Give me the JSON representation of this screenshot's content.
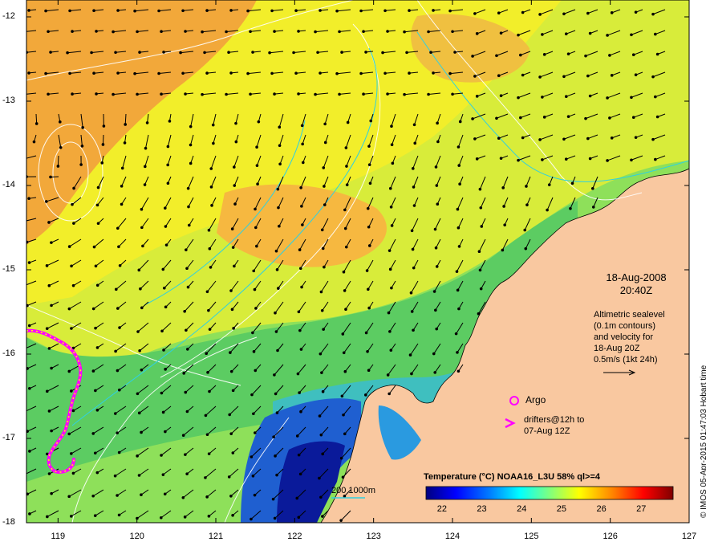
{
  "map": {
    "lon_range": [
      118.6,
      127
    ],
    "lat_range": [
      -18,
      -11.8
    ],
    "x_ticks": [
      "119",
      "120",
      "121",
      "122",
      "123",
      "124",
      "125",
      "126",
      "127"
    ],
    "y_ticks": [
      "-12",
      "-13",
      "-14",
      "-15",
      "-16",
      "-17",
      "-18"
    ],
    "land_color": "#f9c8a0",
    "date_line1": "18-Aug-2008",
    "date_line2": "20:40Z",
    "altimetry_note": "Altimetric sealevel\n(0.1m contours)\nand velocity for\n18-Aug 20Z\n0.5m/s (1kt 24h)",
    "argo_label": "Argo",
    "drifters_label": "drifters@12h to\n07-Aug 12Z",
    "scale_label": "200  1000m",
    "credit": "© IMOS 05-Apr-2015 01:47:03 Hobart time"
  },
  "colorbar": {
    "title": "Temperature (°C) NOAA16_L3U 58% ql>=4",
    "ticks": [
      "22",
      "23",
      "24",
      "25",
      "26",
      "27"
    ],
    "colors": [
      "#00007f",
      "#0000ff",
      "#007fff",
      "#00ffff",
      "#7fff7f",
      "#ffff00",
      "#ff7f00",
      "#ff0000",
      "#7f0000"
    ]
  }
}
